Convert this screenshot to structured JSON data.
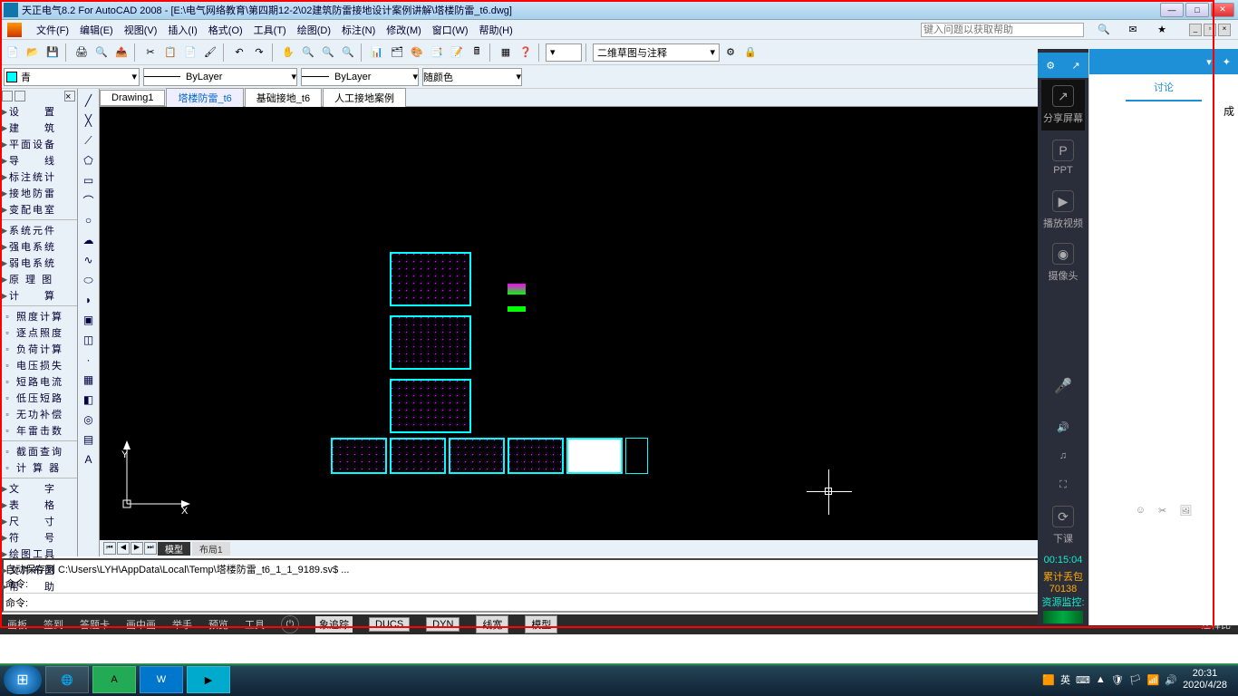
{
  "titlebar": {
    "title": "天正电气8.2 For AutoCAD 2008 - [E:\\电气网络教育\\第四期12-2\\02建筑防雷接地设计案例讲解\\塔楼防雷_t6.dwg]"
  },
  "menubar": {
    "file": "文件(F)",
    "edit": "编辑(E)",
    "view": "视图(V)",
    "insert": "插入(I)",
    "format": "格式(O)",
    "tools": "工具(T)",
    "draw": "绘图(D)",
    "dimension": "标注(N)",
    "modify": "修改(M)",
    "window": "窗口(W)",
    "help": "帮助(H)",
    "help_placeholder": "键入问题以获取帮助"
  },
  "toolbar1": {
    "workspace": "二维草图与注释"
  },
  "toolbar2": {
    "color": "青",
    "linetype": "ByLayer",
    "lineweight": "ByLayer",
    "plotstyle": "随颜色"
  },
  "left_panel": {
    "items1": [
      "设　　置",
      "建　　筑",
      "平面设备",
      "导　　线",
      "标注统计",
      "接地防雷",
      "变配电室"
    ],
    "items2": [
      "系统元件",
      "强电系统",
      "弱电系统",
      "原 理 图",
      "计　　算"
    ],
    "items3": [
      "照度计算",
      "逐点照度",
      "负荷计算",
      "电压损失",
      "短路电流",
      "低压短路",
      "无功补偿",
      "年雷击数"
    ],
    "items4": [
      "截面查询",
      "计 算 器"
    ],
    "items5": [
      "文　　字",
      "表　　格",
      "尺　　寸",
      "符　　号",
      "绘图工具",
      "文件布图",
      "帮　　助"
    ]
  },
  "model_tabs": {
    "t1": "Drawing1",
    "t2": "塔楼防雷_t6",
    "t3": "基础接地_t6",
    "t4": "人工接地案例"
  },
  "layout_tabs": {
    "model": "模型",
    "layout1": "布局1"
  },
  "cmdline": {
    "line1": "自动保存到 C:\\Users\\LYH\\AppData\\Local\\Temp\\塔楼防雷_t6_1_1_9189.sv$ ...",
    "line2": "命令:",
    "line3": "命令:"
  },
  "status": {
    "s1": "画板",
    "s2": "签到",
    "s3": "答题卡",
    "s4": "画中画",
    "s5": "举手",
    "s6": "预览",
    "s7": "工具",
    "snap": "象追踪",
    "ducs": "DUCS",
    "dyn": "DYN",
    "lwt": "线宽",
    "model": "模型",
    "right": "注释比"
  },
  "right_panel": {
    "share": "分享屏幕",
    "ppt": "PPT",
    "video": "播放视频",
    "camera": "摄像头",
    "end": "下课",
    "timer": "00:15:04",
    "loss": "累计丢包",
    "packets": "70138",
    "monitor": "资源监控:"
  },
  "chat": {
    "tab": "讨论",
    "cheng": "成"
  },
  "taskbar": {
    "ime": "英",
    "time": "20:31",
    "date": "2020/4/28"
  }
}
